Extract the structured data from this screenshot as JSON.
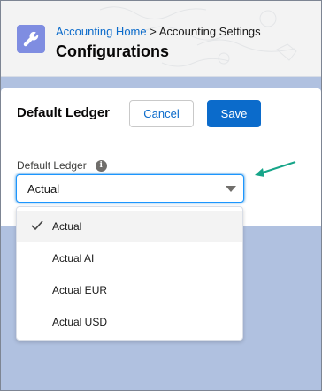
{
  "header": {
    "icon": "wrench-icon",
    "breadcrumb_link": "Accounting Home",
    "breadcrumb_separator": ">",
    "breadcrumb_current": "Accounting Settings",
    "title": "Configurations"
  },
  "card": {
    "title": "Default Ledger",
    "cancel_label": "Cancel",
    "save_label": "Save"
  },
  "field": {
    "label": "Default Ledger",
    "info_glyph": "i",
    "value": "Actual"
  },
  "dropdown": {
    "options": [
      {
        "label": "Actual",
        "selected": true
      },
      {
        "label": "Actual AI",
        "selected": false
      },
      {
        "label": "Actual EUR",
        "selected": false
      },
      {
        "label": "Actual USD",
        "selected": false
      }
    ]
  },
  "colors": {
    "brand": "#0b6bcb",
    "header_icon_bg": "#7f8de1",
    "backdrop": "#b0c1e0",
    "annotation_arrow": "#17a589"
  }
}
